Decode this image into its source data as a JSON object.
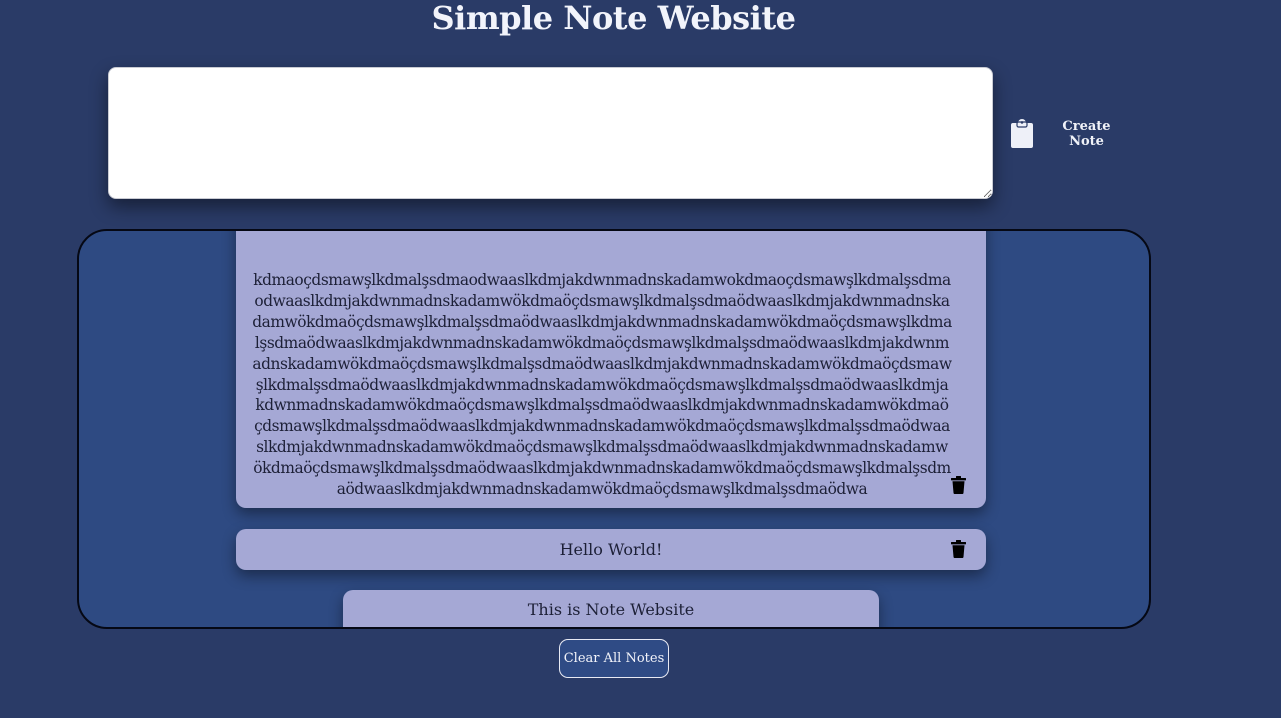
{
  "header": {
    "title": "Simple Note Website"
  },
  "editor": {
    "placeholder": "",
    "value": ""
  },
  "create_button": {
    "label": "Create Note",
    "icon": "clipboard-icon"
  },
  "notes": [
    {
      "text": "kdmaoçdsmawşlkdmalşsdmaodwaaslkdmjakdwnmadnskadamwokdmaoçdsmawşlkdmalşsdmaodwaaslkdmjakdwnmadnskadamwökdmaöçdsmawşlkdmalşsdmaödwaaslkdmjakdwnmadnskadamwökdmaöçdsmawşlkdmalşsdmaödwaaslkdmjakdwnmadnskadamwökdmaöçdsmawşlkdmalşsdmaödwaaslkdmjakdwnmadnskadamwökdmaöçdsmawşlkdmalşsdmaödwaaslkdmjakdwnmadnskadamwökdmaöçdsmawşlkdmalşsdmaödwaaslkdmjakdwnmadnskadamwökdmaöçdsmawşlkdmalşsdmaödwaaslkdmjakdwnmadnskadamwökdmaöçdsmawşlkdmalşsdmaödwaaslkdmjakdwnmadnskadamwökdmaöçdsmawşlkdmalşsdmaödwaaslkdmjakdwnmadnskadamwökdmaöçdsmawşlkdmalşsdmaödwaaslkdmjakdwnmadnskadamwökdmaöçdsmawşlkdmalşsdmaödwaaslkdmjakdwnmadnskadamwökdmaöçdsmawşlkdmalşsdmaödwaaslkdmjakdwnmadnskadamwökdmaöçdsmawşlkdmalşsdmaödwaaslkdmjakdwnmadnskadamwökdmaöçdsmawşlkdmalşsdmaödwaaslkdmjakdwnmadnskadamwökdmaöçdsmawşlkdmalşsdmaödwa"
    },
    {
      "text": "Hello World!"
    },
    {
      "text": "This is Note Website"
    }
  ],
  "delete_icon": "trash-icon",
  "clear_button": {
    "label": "Clear All Notes"
  },
  "colors": {
    "background": "#2a3b67",
    "panel": "#2e4a82",
    "note_card": "#a5a8d5",
    "panel_border": "#050814"
  }
}
